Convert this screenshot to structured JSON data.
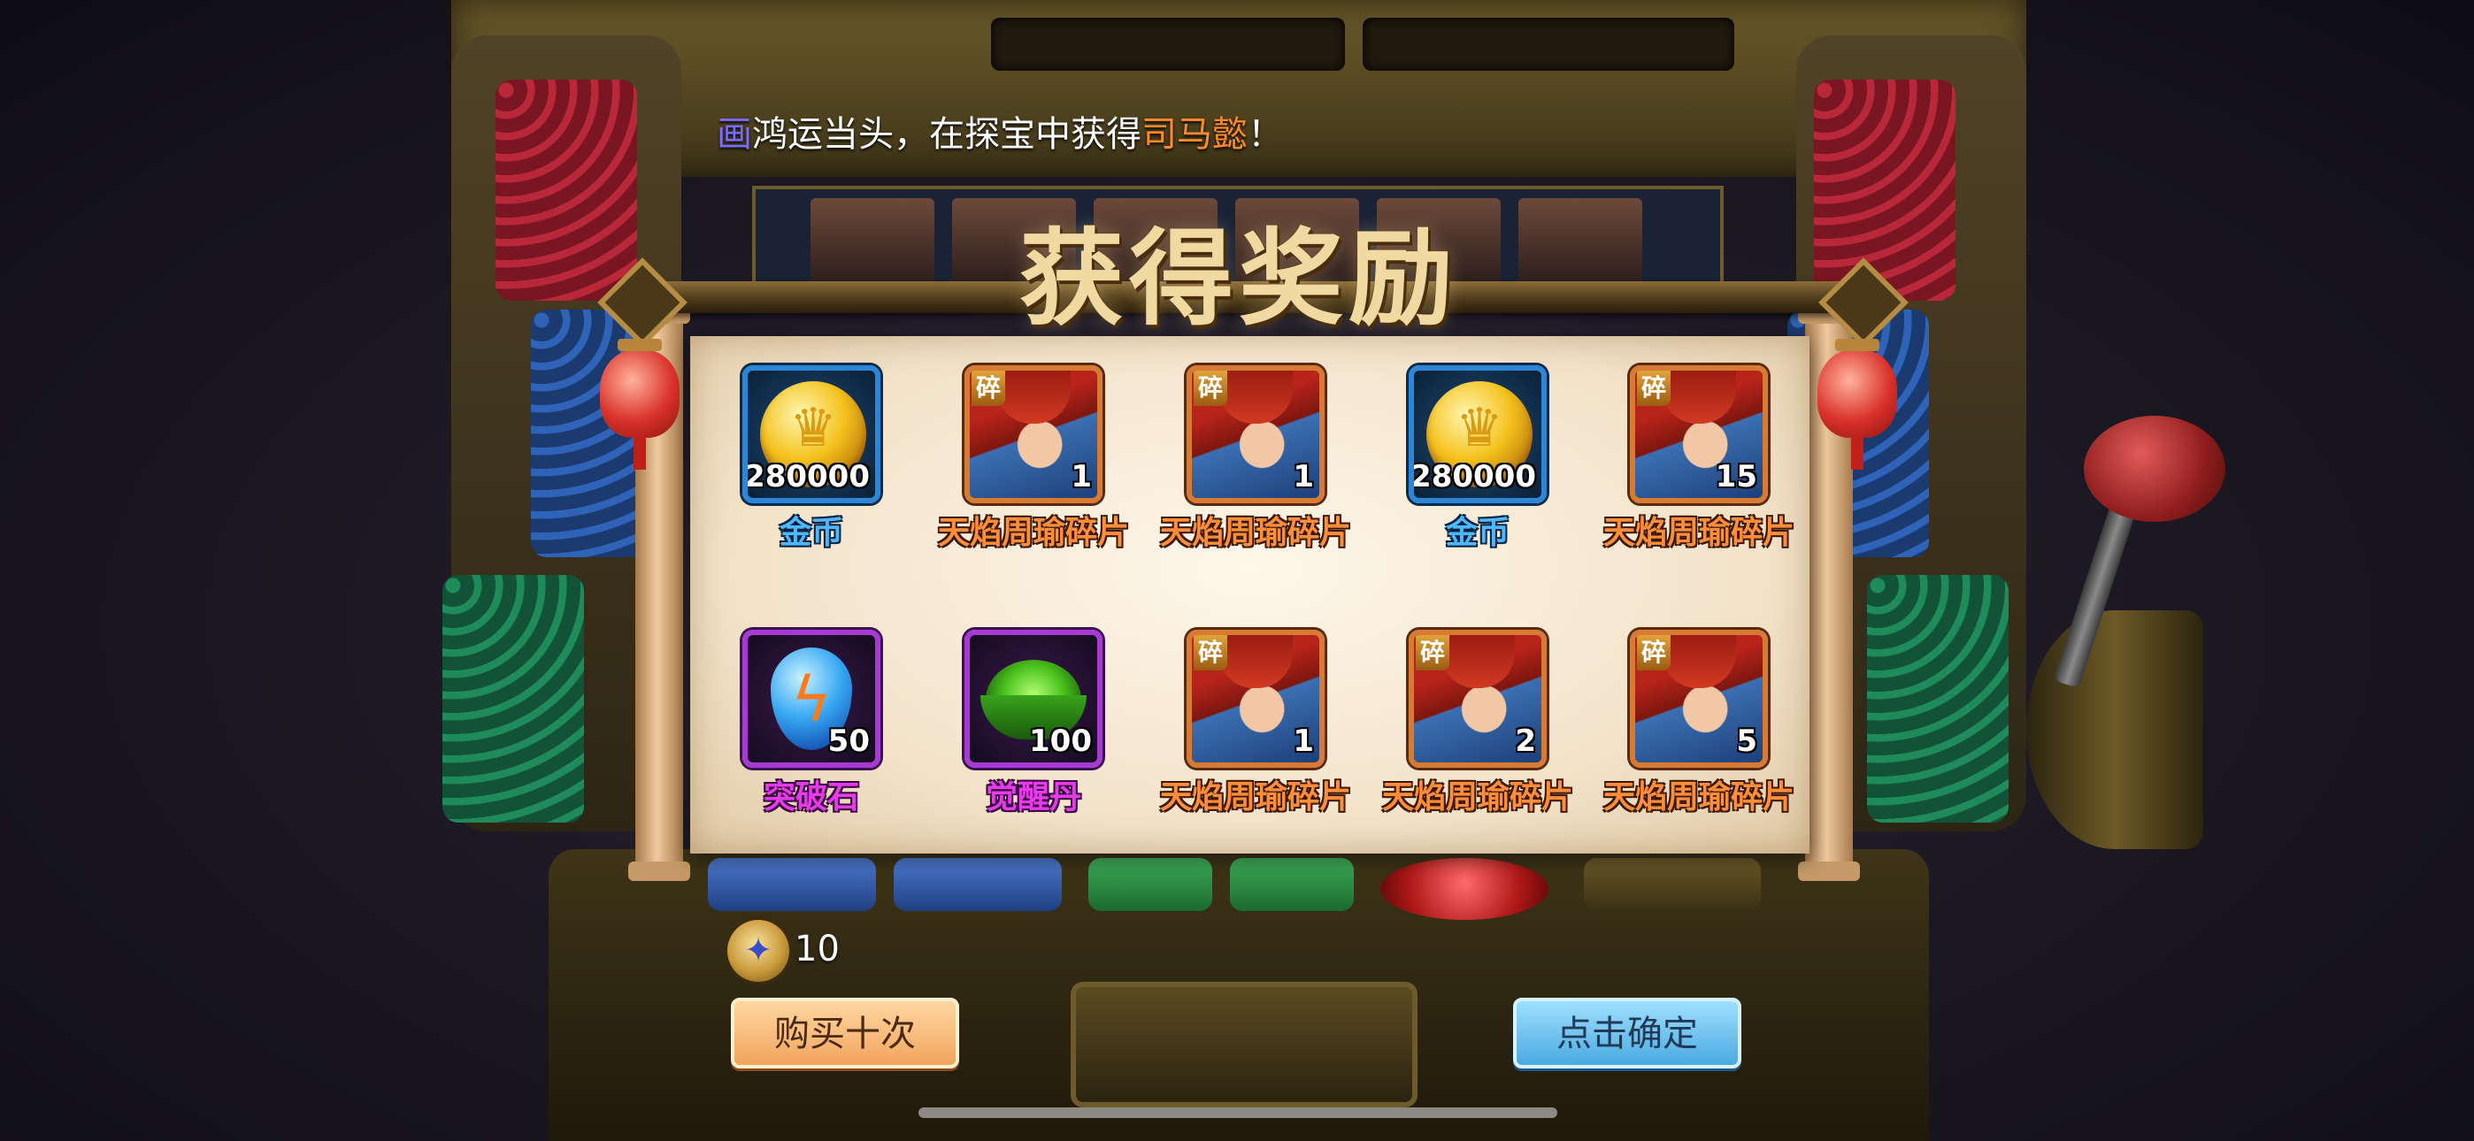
{
  "announcement": {
    "player_name": "画",
    "message": "鸿运当头，在探宝中获得",
    "highlight": "司马懿",
    "end": "！"
  },
  "dialog": {
    "title": "获得奖励",
    "fragment_tag": "碎",
    "rewards": [
      {
        "label": "金币",
        "qty": "280000",
        "rarity": "blue",
        "icon": "gold-coin-icon"
      },
      {
        "label": "天焰周瑜碎片",
        "qty": "1",
        "rarity": "orange",
        "icon": "hero-fragment-icon"
      },
      {
        "label": "天焰周瑜碎片",
        "qty": "1",
        "rarity": "orange",
        "icon": "hero-fragment-icon"
      },
      {
        "label": "金币",
        "qty": "280000",
        "rarity": "blue",
        "icon": "gold-coin-icon"
      },
      {
        "label": "天焰周瑜碎片",
        "qty": "15",
        "rarity": "orange",
        "icon": "hero-fragment-icon"
      },
      {
        "label": "突破石",
        "qty": "50",
        "rarity": "purple",
        "icon": "breakthrough-stone-icon"
      },
      {
        "label": "觉醒丹",
        "qty": "100",
        "rarity": "purple",
        "icon": "awakening-pill-icon"
      },
      {
        "label": "天焰周瑜碎片",
        "qty": "1",
        "rarity": "orange",
        "icon": "hero-fragment-icon"
      },
      {
        "label": "天焰周瑜碎片",
        "qty": "2",
        "rarity": "orange",
        "icon": "hero-fragment-icon"
      },
      {
        "label": "天焰周瑜碎片",
        "qty": "5",
        "rarity": "orange",
        "icon": "hero-fragment-icon"
      }
    ]
  },
  "footer": {
    "ticket_count": "10",
    "buy_ten_label": "购买十次",
    "confirm_label": "点击确定"
  },
  "colors": {
    "rarity_blue": "#2c86d8",
    "rarity_orange": "#d77a34",
    "rarity_purple": "#a73ad2",
    "buy_button": "#f2a45c",
    "confirm_button": "#4aa9e0"
  }
}
